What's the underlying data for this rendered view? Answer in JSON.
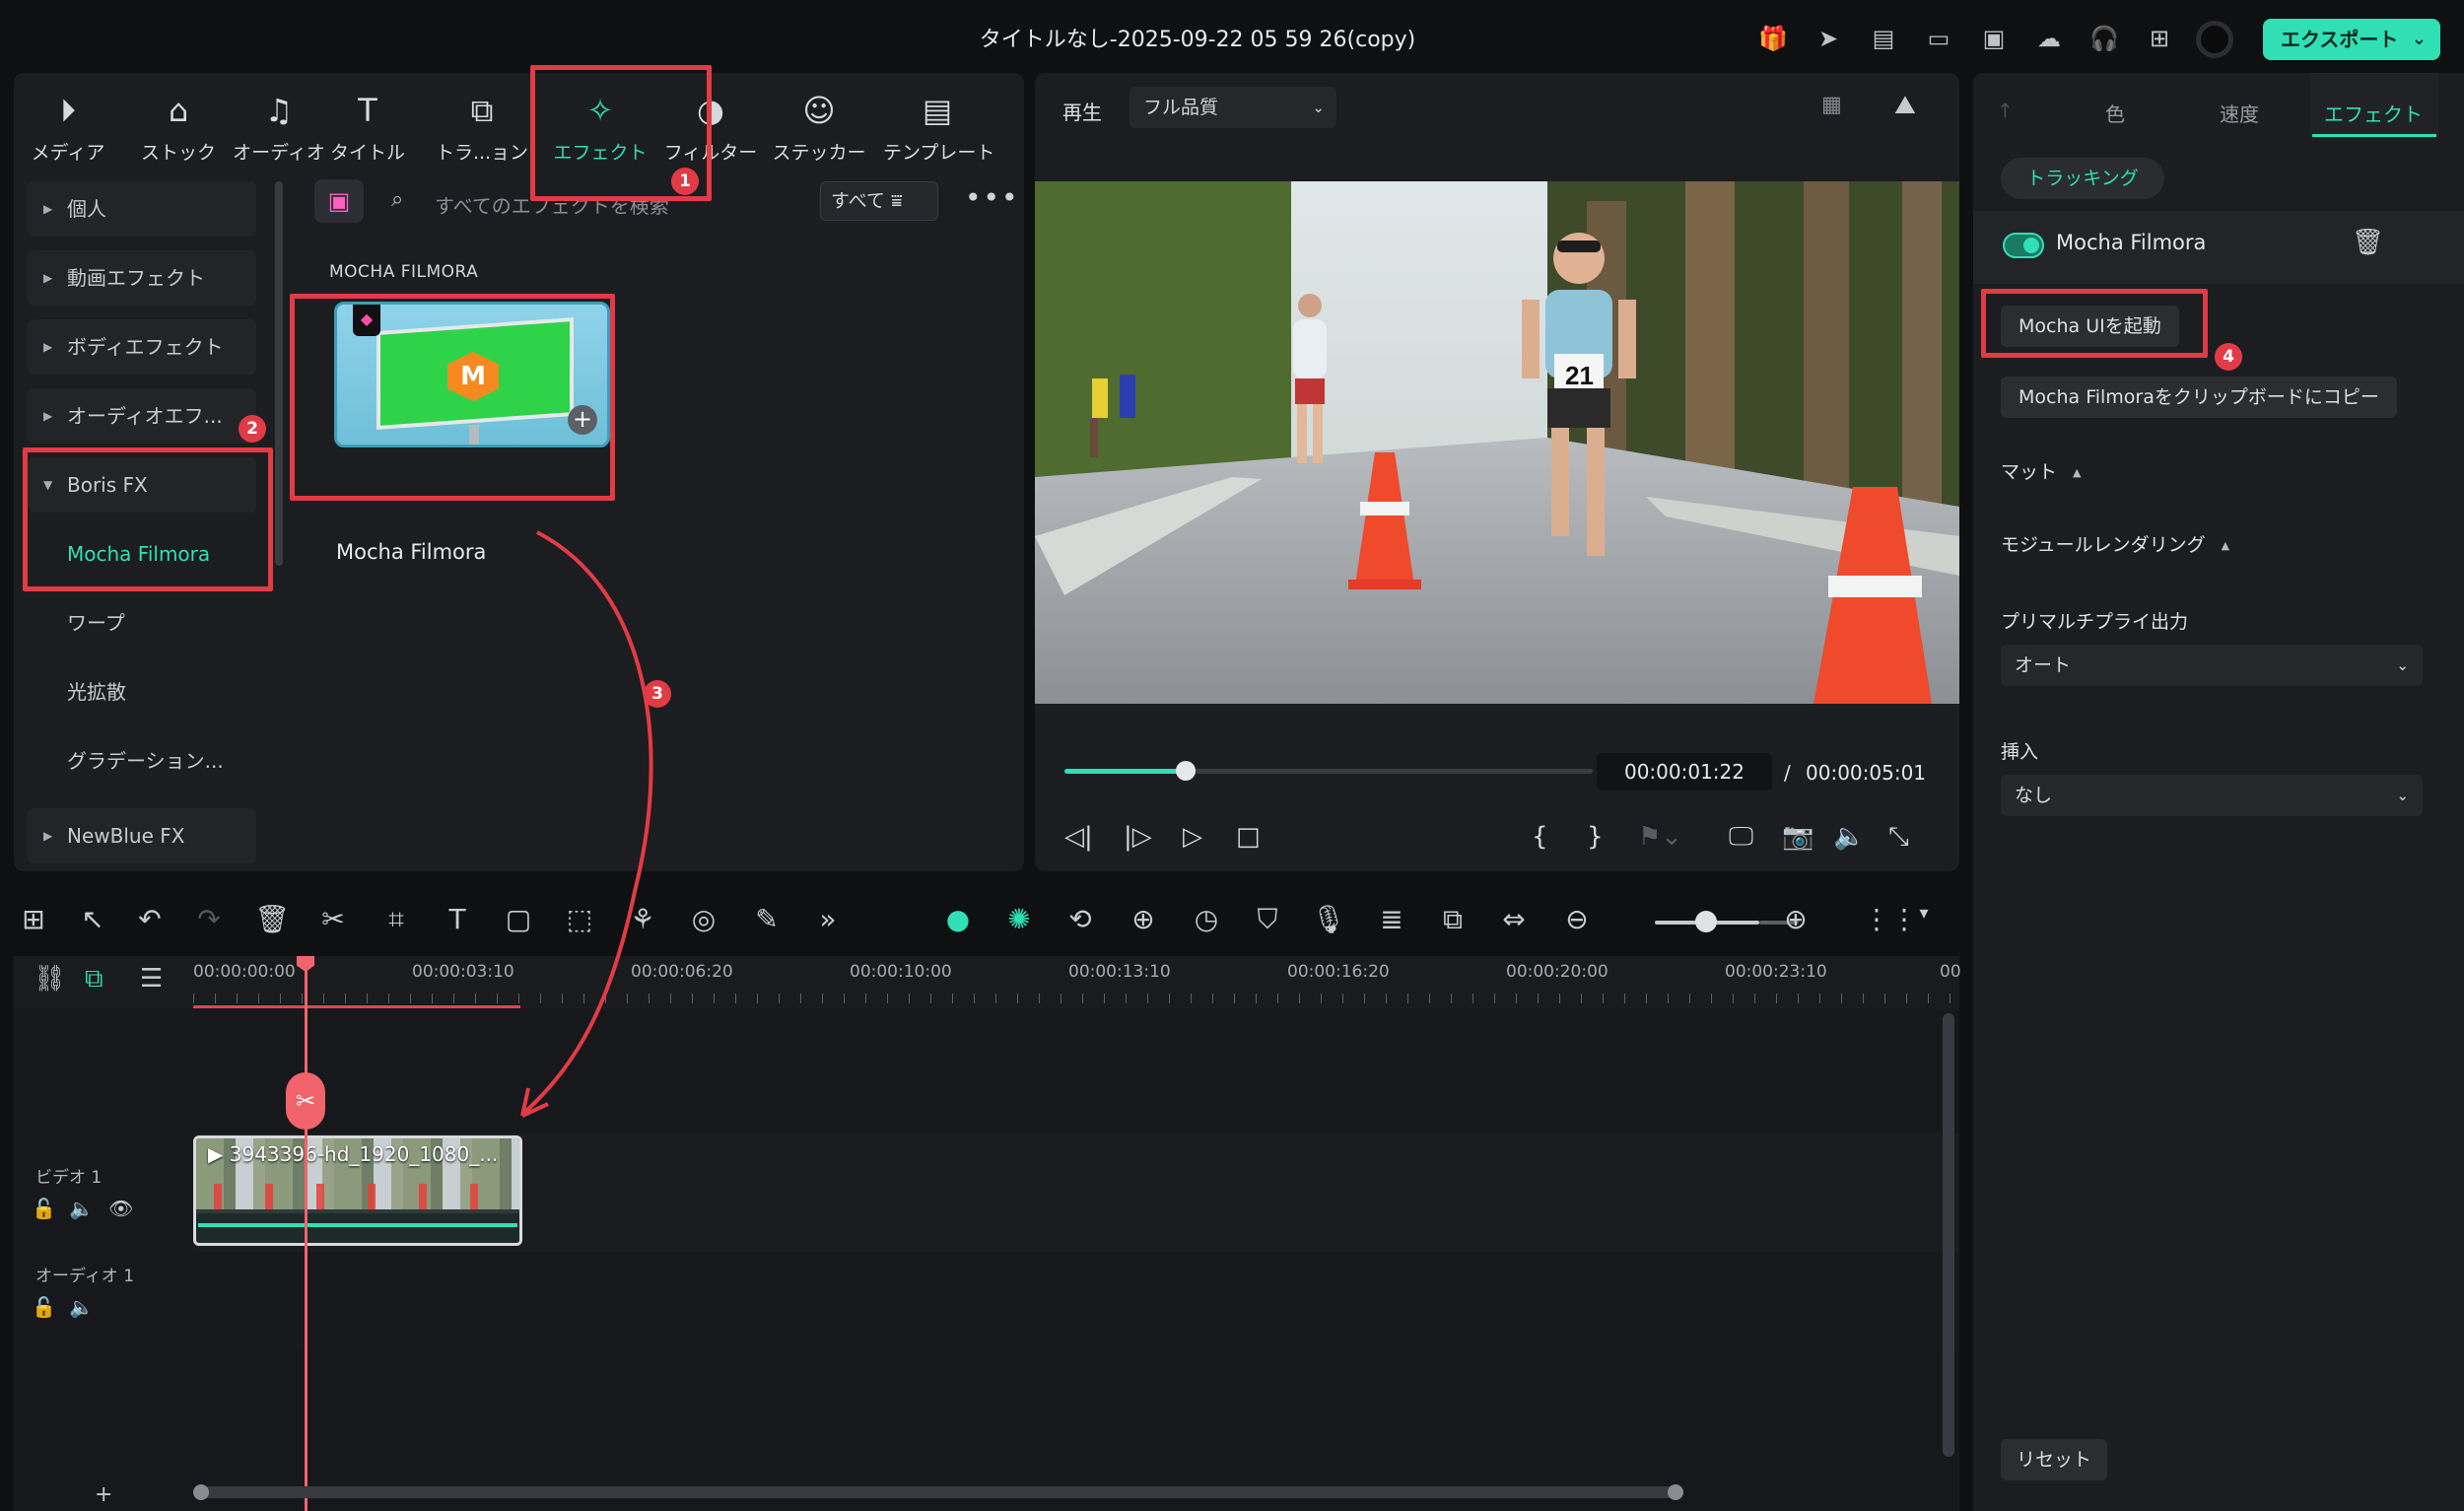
{
  "window": {
    "title": "タイトルなし-2025-09-22 05 59 26(copy)",
    "export_label": "エクスポート"
  },
  "top_icons": [
    "gift-icon",
    "send-icon",
    "clipboard-icon",
    "layout-icon",
    "save-icon",
    "cloud-icon",
    "headset-icon",
    "apps-icon",
    "avatar"
  ],
  "media_tabs": [
    {
      "label": "メディア",
      "icon": "media-icon"
    },
    {
      "label": "ストック",
      "icon": "stock-icon"
    },
    {
      "label": "オーディオ",
      "icon": "music-icon"
    },
    {
      "label": "タイトル",
      "icon": "title-icon"
    },
    {
      "label": "トラ...ョン",
      "icon": "transition-icon"
    },
    {
      "label": "エフェクト",
      "icon": "effects-icon",
      "active": true
    },
    {
      "label": "フィルター",
      "icon": "filter-icon"
    },
    {
      "label": "ステッカー",
      "icon": "sticker-icon"
    },
    {
      "label": "テンプレート",
      "icon": "template-icon"
    }
  ],
  "categories": [
    {
      "label": "個人"
    },
    {
      "label": "動画エフェクト"
    },
    {
      "label": "ボディエフェクト"
    },
    {
      "label": "オーディオエフ..."
    },
    {
      "label": "Boris FX"
    },
    {
      "label": "Mocha Filmora"
    },
    {
      "label": "ワープ"
    },
    {
      "label": "光拡散"
    },
    {
      "label": "グラデーション..."
    },
    {
      "label": "NewBlue FX"
    }
  ],
  "search": {
    "placeholder": "すべてのエフェクトを検索",
    "filter_label": "すべて"
  },
  "effects": {
    "section_label": "MOCHA FILMORA",
    "card_title": "Mocha Filmora",
    "card_logo": "M"
  },
  "preview": {
    "play_label": "再生",
    "quality": "フル品質",
    "progress": 0.23,
    "current_time": "00:00:01:22",
    "separator": "/",
    "total_time": "00:00:05:01",
    "bib_number": "21"
  },
  "right_panel": {
    "tabs": [
      "色",
      "速度",
      "エフェクト"
    ],
    "tracking_label": "トラッキング",
    "effect_name": "Mocha Filmora",
    "launch_label": "Mocha UIを起動",
    "copy_label": "Mocha Filmoraをクリップボードにコピー",
    "matte_label": "マット",
    "module_render_label": "モジュールレンダリング",
    "premultiply_label": "プリマルチプライ出力",
    "premultiply_value": "オート",
    "insert_label": "挿入",
    "insert_value": "なし",
    "reset_label": "リセット"
  },
  "timeline": {
    "ruler": [
      "00:00:00:00",
      "00:00:03:10",
      "00:00:06:20",
      "00:00:10:00",
      "00:00:13:10",
      "00:00:16:20",
      "00:00:20:00",
      "00:00:23:10",
      "00"
    ],
    "clip_name": "3943396-hd_1920_1080_...",
    "video_track": "ビデオ 1",
    "audio_track": "オーディオ 1"
  },
  "annotations": [
    "1",
    "2",
    "3",
    "4"
  ],
  "colors": {
    "accent": "#30dfb4",
    "annotation": "#e23b45",
    "panel": "#1c1d20",
    "background": "#0f1012"
  }
}
